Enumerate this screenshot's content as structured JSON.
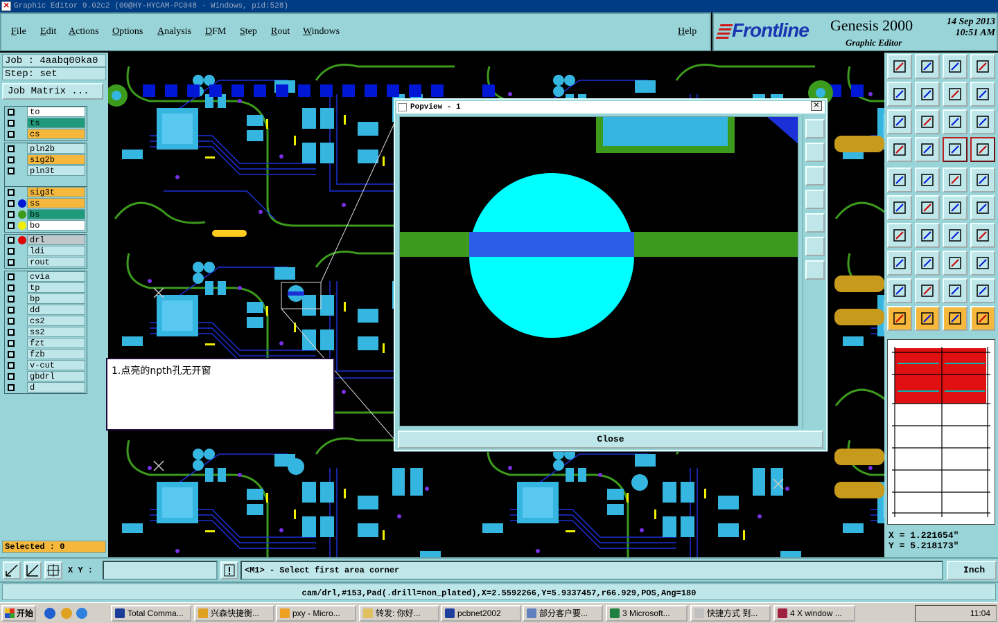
{
  "window": {
    "title": "Graphic Editor 9.02c2 (00@HY-HYCAM-PC048 - Windows, pid:528)"
  },
  "menu": {
    "items": [
      "File",
      "Edit",
      "Actions",
      "Options",
      "Analysis",
      "DFM",
      "Step",
      "Rout",
      "Windows"
    ],
    "help": "Help"
  },
  "brand": {
    "logo": "Frontline",
    "product": "Genesis 2000",
    "subtitle": "Graphic Editor",
    "date": "14 Sep 2013",
    "time": "10:51 AM"
  },
  "job": {
    "job_label": "Job : 4aabq00ka0",
    "step_label": "Step: set",
    "matrix_button": "Job Matrix ..."
  },
  "layers": {
    "group1": [
      {
        "name": "to",
        "color": "#ffffff",
        "dot": ""
      },
      {
        "name": "ts",
        "color": "#1f9a7a",
        "dot": ""
      },
      {
        "name": "cs",
        "color": "#f5b83c",
        "dot": ""
      }
    ],
    "group2": [
      {
        "name": "pln2b",
        "color": "#bfe6e9",
        "dot": ""
      },
      {
        "name": "sig2b",
        "color": "#f5b83c",
        "dot": ""
      },
      {
        "name": "pln3t",
        "color": "#bfe6e9",
        "dot": ""
      }
    ],
    "group3": [
      {
        "name": "sig3t",
        "color": "#f5b83c",
        "dot": ""
      },
      {
        "name": "ss",
        "color": "#f5b83c",
        "dot": "#0018d6"
      },
      {
        "name": "bs",
        "color": "#1f9a7a",
        "dot": "#3c9a1c"
      },
      {
        "name": "bo",
        "color": "#ffffff",
        "dot": "#f0f000"
      }
    ],
    "group4": [
      {
        "name": "drl",
        "color": "#c0c8cc",
        "dot": "#e00000"
      },
      {
        "name": "ldi",
        "color": "#bfe6e9",
        "dot": ""
      },
      {
        "name": "rout",
        "color": "#bfe6e9",
        "dot": ""
      }
    ],
    "group5": [
      {
        "name": "cvia",
        "color": "#bfe6e9",
        "dot": ""
      },
      {
        "name": "tp",
        "color": "#bfe6e9",
        "dot": ""
      },
      {
        "name": "bp",
        "color": "#bfe6e9",
        "dot": ""
      },
      {
        "name": "dd",
        "color": "#bfe6e9",
        "dot": ""
      },
      {
        "name": "cs2",
        "color": "#bfe6e9",
        "dot": ""
      },
      {
        "name": "ss2",
        "color": "#bfe6e9",
        "dot": ""
      },
      {
        "name": "fzt",
        "color": "#bfe6e9",
        "dot": ""
      },
      {
        "name": "fzb",
        "color": "#bfe6e9",
        "dot": ""
      },
      {
        "name": "v-cut",
        "color": "#bfe6e9",
        "dot": ""
      },
      {
        "name": "gbdrl",
        "color": "#bfe6e9",
        "dot": ""
      },
      {
        "name": "d",
        "color": "#bfe6e9",
        "dot": ""
      }
    ]
  },
  "selected": "Selected : 0",
  "popup": {
    "title": "Popview - 1",
    "close_label": "Close"
  },
  "annotation": "1.点亮的npth孔无开窗",
  "coords": {
    "x": "X = 1.221654\"",
    "y": "Y = 5.218173\""
  },
  "cmdbar": {
    "xy_label": "X Y :",
    "xy_value": "",
    "prompt": "<M1> - Select first area corner",
    "unit": "Inch"
  },
  "status": "cam/drl,#153,Pad(.drill=non_plated),X=2.5592266,Y=5.9337457,r66.929,POS,Ang=180",
  "taskbar": {
    "start": "开始",
    "tasks": [
      "Total Comma...",
      "兴森快捷衡...",
      "pxy - Micro...",
      "转发: 你好...",
      "pcbnet2002",
      "部分客户要...",
      "3 Microsoft...",
      "快捷方式 到...",
      "4 X window ..."
    ],
    "clock": "11:04"
  },
  "colors": {
    "panel": "#98d4d8",
    "board_green": "#3c9a1c",
    "pad_cyan": "#35b6e0",
    "trace_blue": "#1c30d8",
    "drill_cyan": "#00ffff",
    "highlight_red": "#e01010"
  }
}
